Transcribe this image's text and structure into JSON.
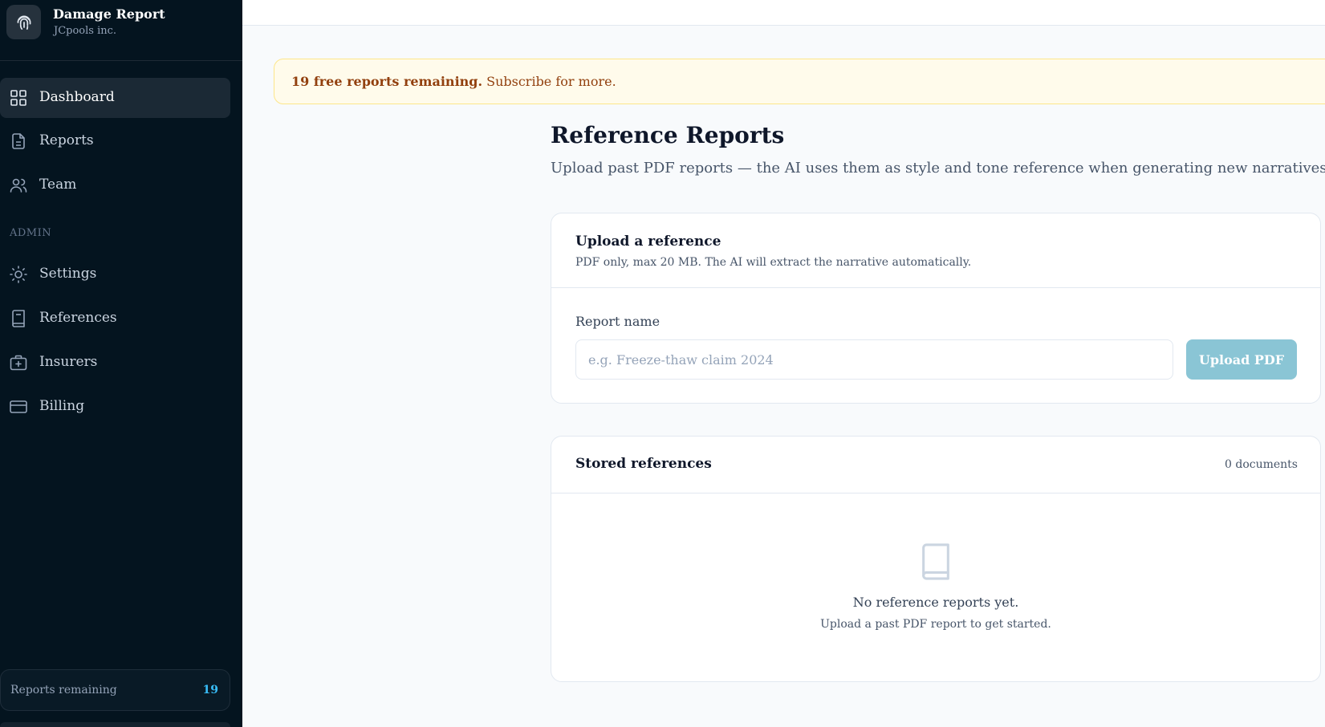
{
  "brand": {
    "title": "Damage Report",
    "subtitle": "JCpools inc.",
    "logo_icon": "fingerprint-icon"
  },
  "nav": {
    "items": [
      {
        "label": "Dashboard",
        "icon": "grid-icon",
        "active": true
      },
      {
        "label": "Reports",
        "icon": "file-icon"
      },
      {
        "label": "Team",
        "icon": "users-icon"
      }
    ],
    "admin_label": "ADMIN",
    "admin_items": [
      {
        "label": "Settings",
        "icon": "sun-icon"
      },
      {
        "label": "References",
        "icon": "book-icon"
      },
      {
        "label": "Insurers",
        "icon": "briefcase-plus-icon"
      },
      {
        "label": "Billing",
        "icon": "credit-card-icon"
      }
    ]
  },
  "sidebar_footer": {
    "label": "Reports remaining",
    "value": "19"
  },
  "banner": {
    "bold": "19 free reports remaining.",
    "text": " Subscribe for more."
  },
  "page": {
    "title": "Reference Reports",
    "subtitle": "Upload past PDF reports — the AI uses them as style and tone reference when generating new narratives."
  },
  "upload_card": {
    "title": "Upload a reference",
    "subtitle": "PDF only, max 20 MB. The AI will extract the narrative automatically.",
    "field_label": "Report name",
    "placeholder": "e.g. Freeze-thaw claim 2024",
    "value": "",
    "button": "Upload PDF"
  },
  "stored_card": {
    "title": "Stored references",
    "count": "0 documents",
    "empty_title": "No reference reports yet.",
    "empty_sub": "Upload a past PDF report to get started."
  },
  "colors": {
    "sidebar_bg": "#04141f",
    "accent": "#38bdf8",
    "button": "#8ac5d5",
    "banner_bg": "#fffbeb",
    "banner_text": "#92400e"
  }
}
